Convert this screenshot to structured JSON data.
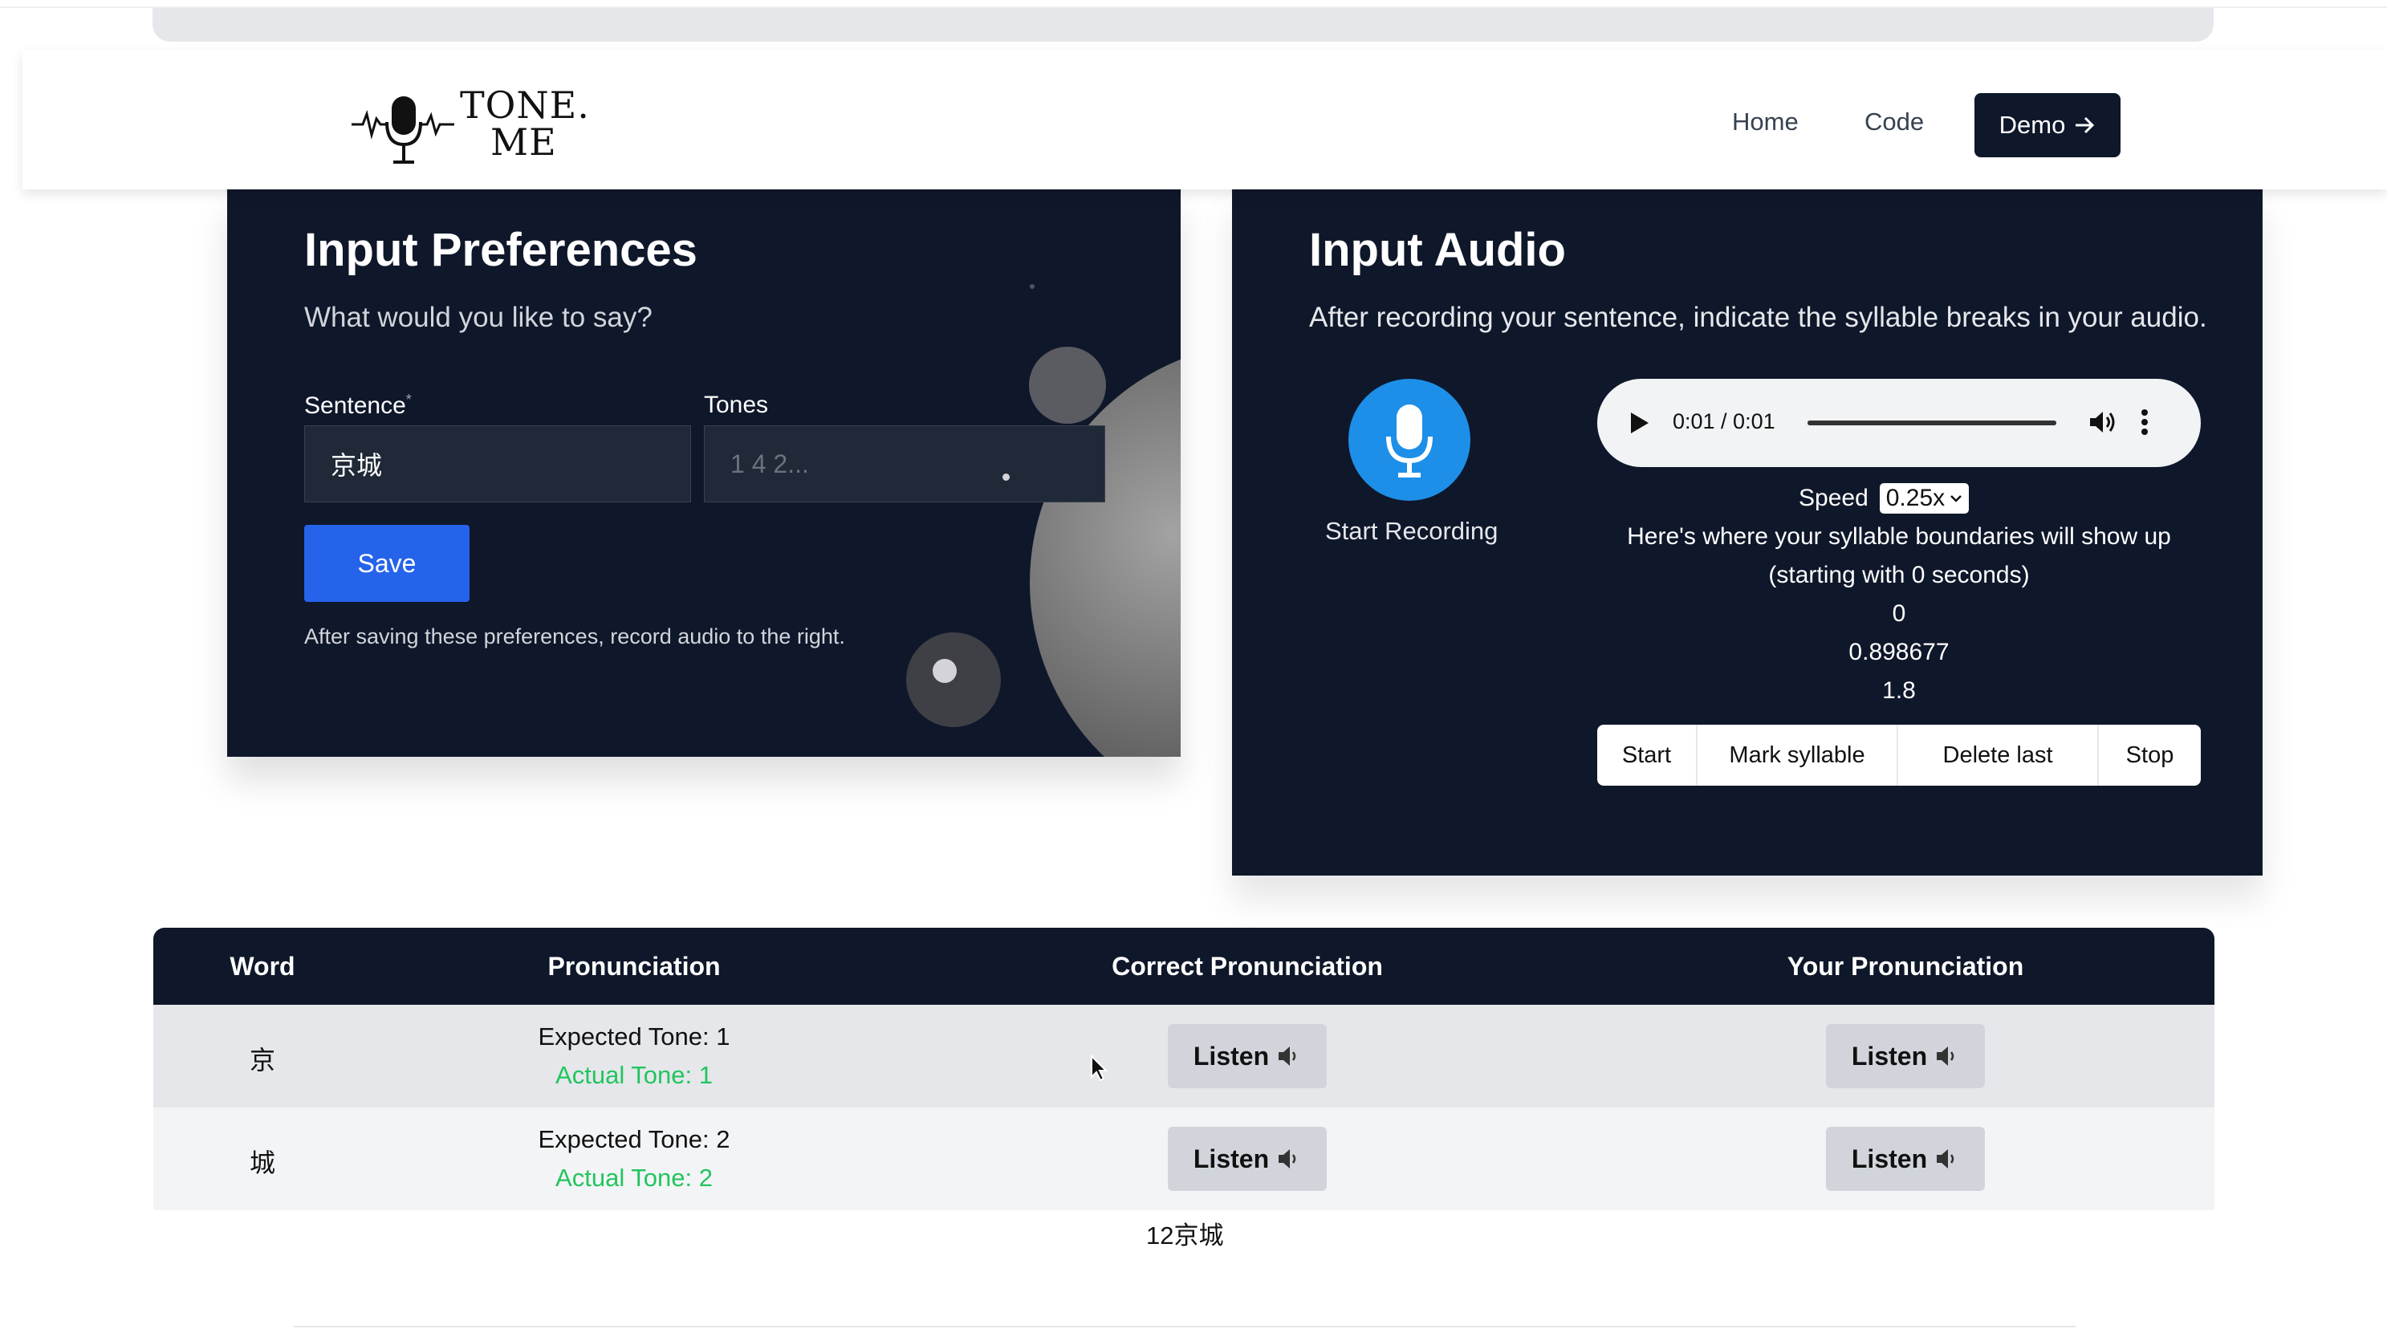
{
  "nav": {
    "logo_line1": "TONE.",
    "logo_line2": "ME",
    "links": [
      "Home",
      "Code"
    ],
    "demo_label": "Demo"
  },
  "preferences": {
    "title": "Input Preferences",
    "subtitle": "What would you like to say?",
    "sentence_label": "Sentence",
    "required_mark": "*",
    "sentence_value": "京城",
    "tones_label": "Tones",
    "tones_placeholder": "1 4 2...",
    "save_label": "Save",
    "hint": "After saving these preferences, record audio to the right."
  },
  "audio": {
    "title": "Input Audio",
    "subtitle": "After recording your sentence, indicate the syllable breaks in your audio.",
    "record_label": "Start Recording",
    "player_time": "0:01 / 0:01",
    "player_progress": 1.0,
    "speed_label": "Speed",
    "speed_value": "0.25x",
    "boundaries_text_1": "Here's where your syllable boundaries will show up",
    "boundaries_text_2": "(starting with 0 seconds)",
    "boundaries": [
      "0",
      "0.898677",
      "1.8"
    ],
    "buttons": [
      "Start",
      "Mark syllable",
      "Delete last",
      "Stop"
    ]
  },
  "table": {
    "headers": [
      "Word",
      "Pronunciation",
      "Correct Pronunciation",
      "Your Pronunciation"
    ],
    "rows": [
      {
        "word": "京",
        "expected": "Expected Tone: 1",
        "actual": "Actual Tone: 1",
        "listen_correct": "Listen",
        "listen_yours": "Listen"
      },
      {
        "word": "城",
        "expected": "Expected Tone: 2",
        "actual": "Actual Tone: 2",
        "listen_correct": "Listen",
        "listen_yours": "Listen"
      }
    ],
    "actual_color": "#22c55e"
  },
  "summary": "12京城",
  "colors": {
    "panel_bg": "#0f172a",
    "save_button": "#2563eb",
    "mic_button": "#1d8fe8"
  }
}
